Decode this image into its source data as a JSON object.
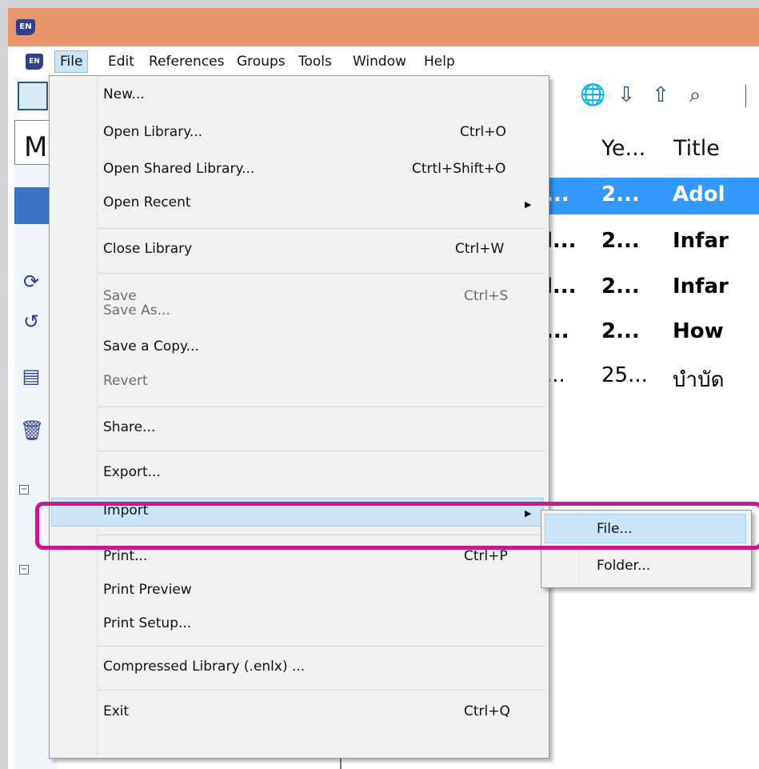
{
  "app": {
    "logo": "EN"
  },
  "menubar": {
    "items": [
      "File",
      "Edit",
      "References",
      "Groups",
      "Tools",
      "Window",
      "Help"
    ]
  },
  "toolbar": {
    "icons": [
      "folder-icon",
      "online-search-icon",
      "import-icon",
      "export-icon",
      "find-full-text-icon"
    ]
  },
  "left_panel": {
    "header_letter": "M"
  },
  "columns": {
    "year": "Ye...",
    "title": "Title"
  },
  "references": [
    {
      "author": "...",
      "year": "2...",
      "title": "Adol",
      "selected": true,
      "bold": true
    },
    {
      "author": "l...",
      "year": "2...",
      "title": "Infar",
      "selected": false,
      "bold": true
    },
    {
      "author": "l...",
      "year": "2...",
      "title": "Infar",
      "selected": false,
      "bold": true
    },
    {
      "author": "...",
      "year": "2...",
      "title": "How",
      "selected": false,
      "bold": true
    },
    {
      "author": "...",
      "year": "25...",
      "title": "บำบัด",
      "selected": false,
      "bold": false
    }
  ],
  "file_menu": {
    "items": [
      {
        "label": "New...",
        "shortcut": ""
      },
      {
        "label": "Open Library...",
        "shortcut": "Ctrl+O"
      },
      {
        "label": "Open Shared Library...",
        "shortcut": "Ctrtl+Shift+O"
      },
      {
        "label": "Open Recent",
        "shortcut": "",
        "submenu": true
      },
      {
        "label": "Close Library",
        "shortcut": "Ctrl+W"
      },
      {
        "label": "Save",
        "shortcut": "Ctrl+S",
        "disabled": true
      },
      {
        "label": "Save As...",
        "shortcut": "",
        "disabled": true
      },
      {
        "label": "Save a Copy...",
        "shortcut": ""
      },
      {
        "label": "Revert",
        "shortcut": "",
        "disabled": true
      },
      {
        "label": "Share...",
        "shortcut": ""
      },
      {
        "label": "Export...",
        "shortcut": ""
      },
      {
        "label": "Import",
        "shortcut": "",
        "submenu": true,
        "highlighted": true
      },
      {
        "label": "Print...",
        "shortcut": "Ctrl+P"
      },
      {
        "label": "Print Preview",
        "shortcut": ""
      },
      {
        "label": "Print Setup...",
        "shortcut": ""
      },
      {
        "label": "Compressed Library (.enlx) ...",
        "shortcut": ""
      },
      {
        "label": "Exit",
        "shortcut": "Ctrl+Q"
      }
    ]
  },
  "import_submenu": {
    "items": [
      {
        "label": "File...",
        "highlighted": true
      },
      {
        "label": "Folder..."
      }
    ]
  },
  "colors": {
    "titlebar": "#e8956b",
    "selection": "#3399ff",
    "menu_highlight": "#cce4f7",
    "annotation": "#c51a8f"
  }
}
